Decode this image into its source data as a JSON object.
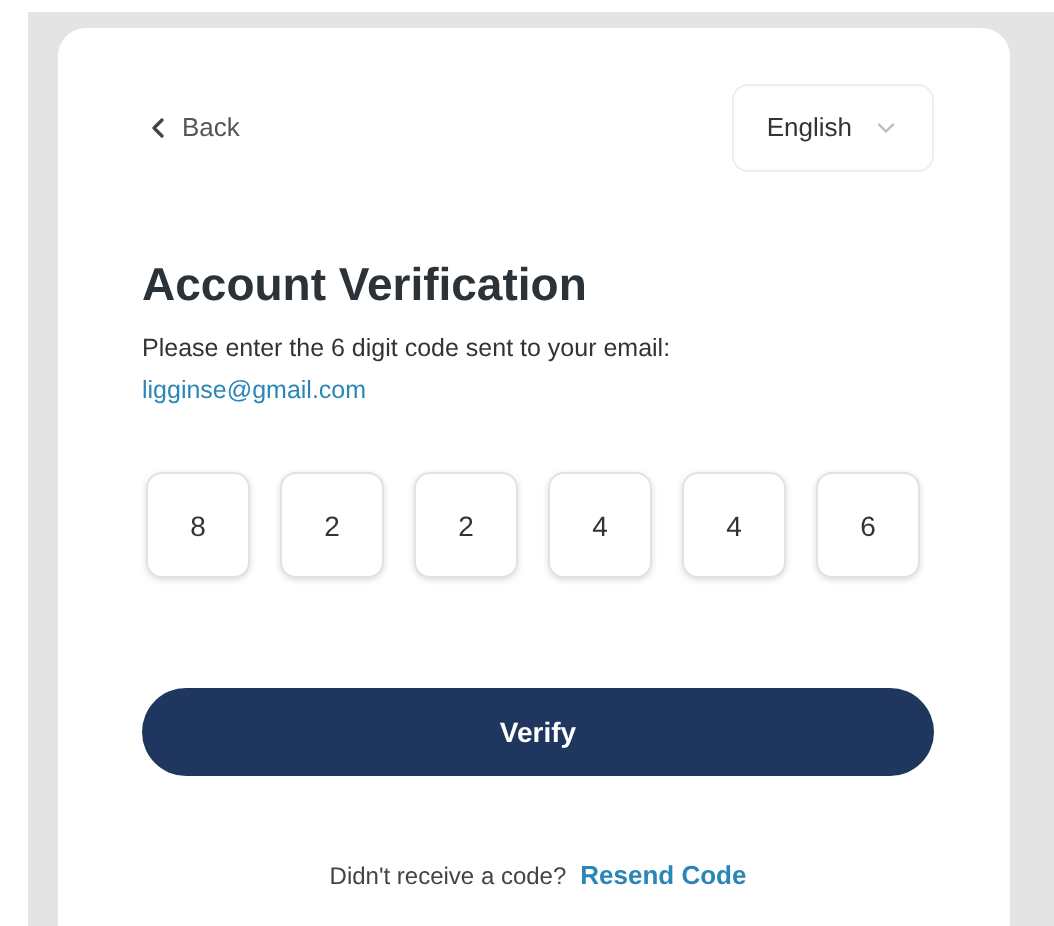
{
  "back": {
    "label": "Back"
  },
  "language": {
    "value": "English"
  },
  "title": "Account Verification",
  "instructions": "Please enter the 6 digit code sent to your email:",
  "email": "ligginse@gmail.com",
  "code_digits": [
    "8",
    "2",
    "2",
    "4",
    "4",
    "6"
  ],
  "verify_button": "Verify",
  "resend": {
    "prompt": "Didn't receive a code?",
    "link": "Resend Code"
  }
}
